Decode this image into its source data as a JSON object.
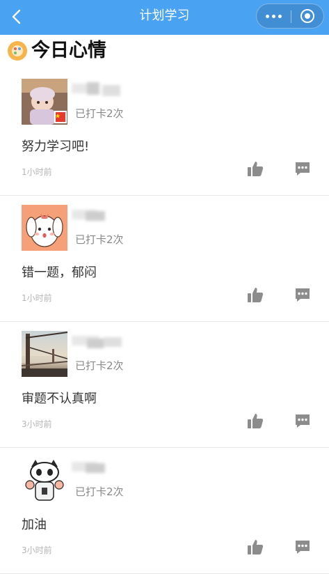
{
  "navbar": {
    "title": "计划学习",
    "background": "#4aa2f2"
  },
  "section": {
    "title": "今日心情",
    "icon": "palette-icon"
  },
  "posts": [
    {
      "avatar": "baby-photo",
      "checkin": "已打卡2次",
      "content": "努力学习吧!",
      "time": "1小时前"
    },
    {
      "avatar": "cartoon-dog",
      "checkin": "已打卡2次",
      "content": "错一题，郁闷",
      "time": "1小时前"
    },
    {
      "avatar": "bridge-photo",
      "checkin": "已打卡2次",
      "content": "审题不认真啊",
      "time": "3小时前"
    },
    {
      "avatar": "cartoon-cat",
      "checkin": "已打卡2次",
      "content": "加油",
      "time": "3小时前"
    }
  ],
  "icons": {
    "like": "thumbs-up-icon",
    "comment": "comment-icon",
    "back": "chevron-left-icon",
    "more": "more-icon",
    "close": "close-circle-icon"
  },
  "colors": {
    "icon_gray": "#8c8c8c",
    "text_muted": "#888888"
  }
}
